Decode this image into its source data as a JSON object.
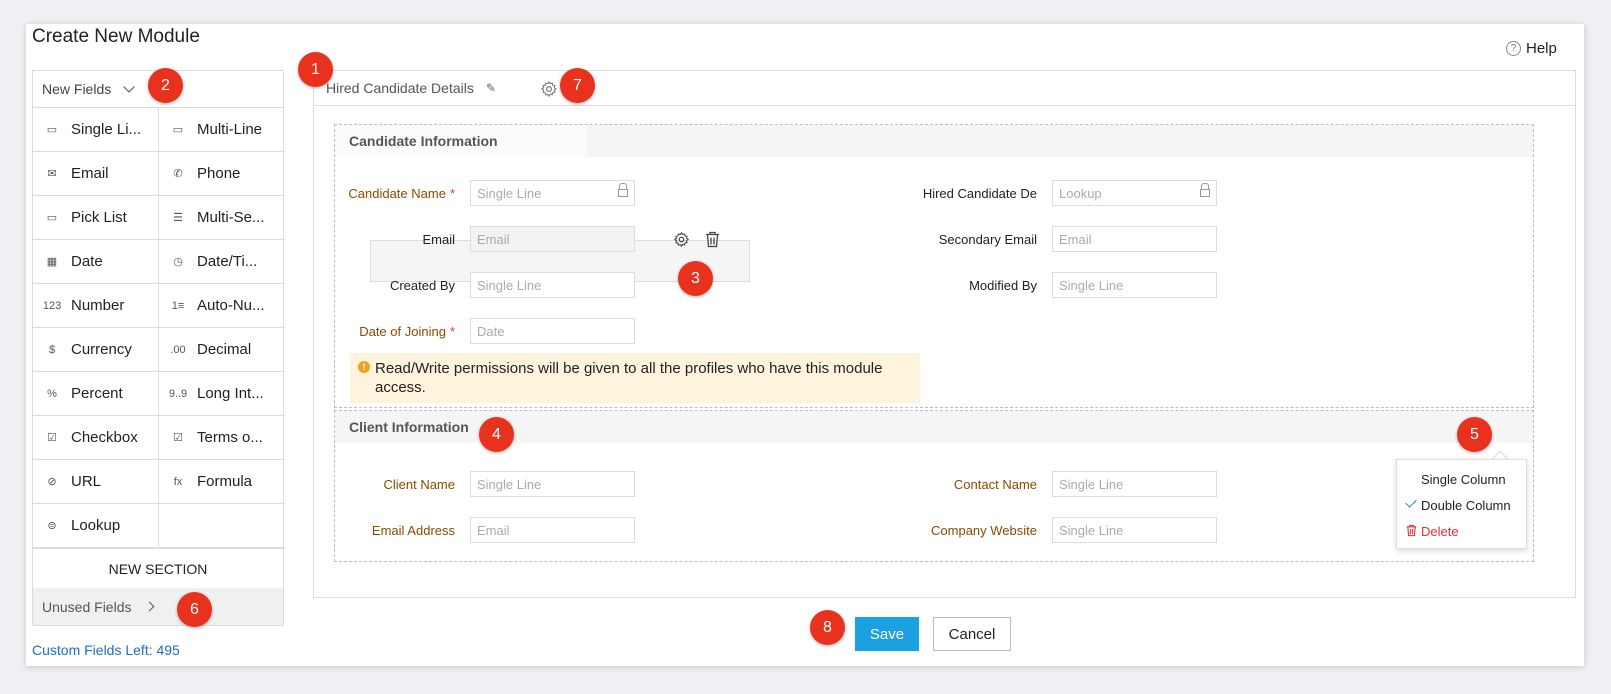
{
  "page": {
    "title": "Create New Module",
    "help_label": "Help"
  },
  "badges": [
    "1",
    "2",
    "3",
    "4",
    "5",
    "6",
    "7",
    "8"
  ],
  "sidebar": {
    "dropdown_label": "New Fields",
    "fields": [
      {
        "label": "Single Li...",
        "icon": "single-line-icon",
        "glyph": "▭"
      },
      {
        "label": "Multi-Line",
        "icon": "multi-line-icon",
        "glyph": "▭"
      },
      {
        "label": "Email",
        "icon": "email-icon",
        "glyph": "✉"
      },
      {
        "label": "Phone",
        "icon": "phone-icon",
        "glyph": "✆"
      },
      {
        "label": "Pick List",
        "icon": "pick-list-icon",
        "glyph": "▭"
      },
      {
        "label": "Multi-Se...",
        "icon": "multi-select-icon",
        "glyph": "☰"
      },
      {
        "label": "Date",
        "icon": "date-icon",
        "glyph": "▦"
      },
      {
        "label": "Date/Ti...",
        "icon": "date-time-icon",
        "glyph": "◷"
      },
      {
        "label": "Number",
        "icon": "number-icon",
        "glyph": "123"
      },
      {
        "label": "Auto-Nu...",
        "icon": "auto-number-icon",
        "glyph": "1≡"
      },
      {
        "label": "Currency",
        "icon": "currency-icon",
        "glyph": "$"
      },
      {
        "label": "Decimal",
        "icon": "decimal-icon",
        "glyph": ".00"
      },
      {
        "label": "Percent",
        "icon": "percent-icon",
        "glyph": "%"
      },
      {
        "label": "Long Int...",
        "icon": "long-integer-icon",
        "glyph": "9..9"
      },
      {
        "label": "Checkbox",
        "icon": "checkbox-icon",
        "glyph": "☑"
      },
      {
        "label": "Terms o...",
        "icon": "terms-icon",
        "glyph": "☑"
      },
      {
        "label": "URL",
        "icon": "url-icon",
        "glyph": "⊘"
      },
      {
        "label": "Formula",
        "icon": "formula-icon",
        "glyph": "fx"
      },
      {
        "label": "Lookup",
        "icon": "lookup-icon",
        "glyph": "⊜"
      }
    ],
    "new_section_label": "NEW SECTION",
    "unused_fields_label": "Unused Fields",
    "custom_fields_left": "Custom Fields Left: 495"
  },
  "layout": {
    "title": "Hired Candidate Details",
    "sections": [
      {
        "title": "Candidate Information",
        "fields": [
          {
            "label": "Candidate Name",
            "required": true,
            "placeholder": "Single Line",
            "locked": true
          },
          {
            "label": "Hired Candidate De",
            "required": false,
            "placeholder": "Lookup",
            "locked": true
          },
          {
            "label": "Email",
            "required": false,
            "placeholder": "Email",
            "locked": false
          },
          {
            "label": "Secondary Email",
            "required": false,
            "placeholder": "Email",
            "locked": false
          },
          {
            "label": "Created By",
            "required": false,
            "placeholder": "Single Line",
            "locked": false
          },
          {
            "label": "Modified By",
            "required": false,
            "placeholder": "Single Line",
            "locked": false
          },
          {
            "label": "Date of Joining",
            "required": true,
            "placeholder": "Date",
            "locked": false
          }
        ],
        "note": "Read/Write permissions will be given to all the profiles who have this module access."
      },
      {
        "title": "Client Information",
        "fields": [
          {
            "label": "Client Name",
            "placeholder": "Single Line"
          },
          {
            "label": "Contact Name",
            "placeholder": "Single Line"
          },
          {
            "label": "Email Address",
            "placeholder": "Email"
          },
          {
            "label": "Company Website",
            "placeholder": "Single Line"
          }
        ],
        "menu": {
          "options": [
            "Single Column",
            "Double Column",
            "Delete"
          ],
          "selected": "Double Column"
        }
      }
    ]
  },
  "footer": {
    "save_label": "Save",
    "cancel_label": "Cancel"
  },
  "colors": {
    "accent": "#1ba0e2",
    "badge": "#e8321e",
    "required_label": "#8a4a00",
    "note_bg": "#fef3dc",
    "link": "#1e6fc4",
    "delete": "#e03030"
  }
}
